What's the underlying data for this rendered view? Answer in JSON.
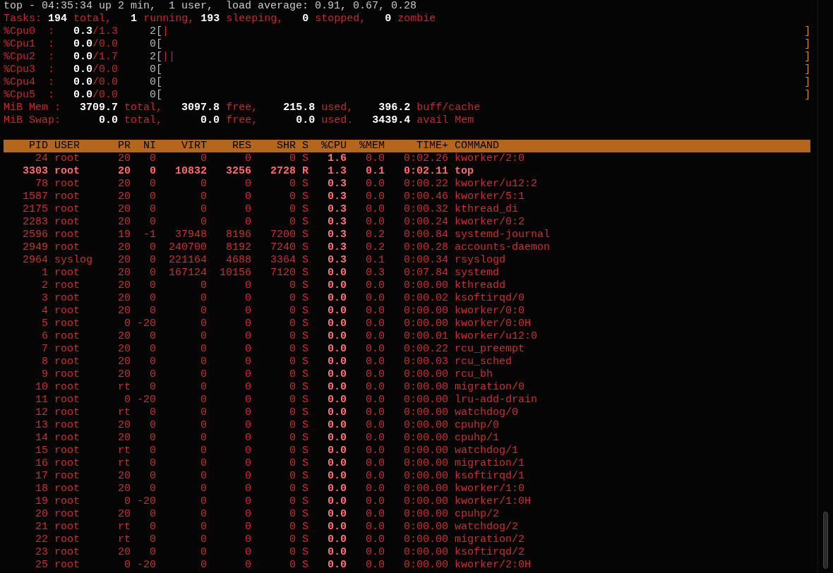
{
  "summary": {
    "uptime": "top - 04:35:34 up 2 min,  1 user,  load average: 0.91, 0.67, 0.28",
    "lines": [
      {
        "segments": [
          {
            "kind": "label",
            "text": "Tasks:"
          },
          {
            "kind": "value",
            "text": " 194"
          },
          {
            "kind": "label",
            "text": " total,"
          },
          {
            "kind": "value",
            "text": "   1"
          },
          {
            "kind": "label",
            "text": " running,"
          },
          {
            "kind": "value",
            "text": " 193"
          },
          {
            "kind": "label",
            "text": " sleeping,"
          },
          {
            "kind": "value",
            "text": "   0"
          },
          {
            "kind": "label",
            "text": " stopped,"
          },
          {
            "kind": "value",
            "text": "   0"
          },
          {
            "kind": "label",
            "text": " zombie"
          }
        ]
      },
      {
        "segments": [
          {
            "kind": "label",
            "text": "%Cpu0  :"
          },
          {
            "kind": "value",
            "text": "   0.3"
          },
          {
            "kind": "label",
            "text": "/1.3"
          },
          {
            "kind": "dim",
            "text": "     2["
          }
        ],
        "meter": "|",
        "meter_end": "]"
      },
      {
        "segments": [
          {
            "kind": "label",
            "text": "%Cpu1  :"
          },
          {
            "kind": "value",
            "text": "   0.0"
          },
          {
            "kind": "label",
            "text": "/0.0"
          },
          {
            "kind": "dim",
            "text": "     0["
          }
        ],
        "meter_end": "]"
      },
      {
        "segments": [
          {
            "kind": "label",
            "text": "%Cpu2  :"
          },
          {
            "kind": "value",
            "text": "   0.0"
          },
          {
            "kind": "label",
            "text": "/1.7"
          },
          {
            "kind": "dim",
            "text": "     2["
          }
        ],
        "meter": "||",
        "meter_end": "]"
      },
      {
        "segments": [
          {
            "kind": "label",
            "text": "%Cpu3  :"
          },
          {
            "kind": "value",
            "text": "   0.0"
          },
          {
            "kind": "label",
            "text": "/0.0"
          },
          {
            "kind": "dim",
            "text": "     0["
          }
        ],
        "meter_end": "]"
      },
      {
        "segments": [
          {
            "kind": "label",
            "text": "%Cpu4  :"
          },
          {
            "kind": "value",
            "text": "   0.0"
          },
          {
            "kind": "label",
            "text": "/0.0"
          },
          {
            "kind": "dim",
            "text": "     0["
          }
        ],
        "meter_end": "]"
      },
      {
        "segments": [
          {
            "kind": "label",
            "text": "%Cpu5  :"
          },
          {
            "kind": "value",
            "text": "   0.0"
          },
          {
            "kind": "label",
            "text": "/0.0"
          },
          {
            "kind": "dim",
            "text": "     0["
          }
        ],
        "meter_end": "]"
      },
      {
        "segments": [
          {
            "kind": "label",
            "text": "MiB Mem :"
          },
          {
            "kind": "value",
            "text": "   3709.7"
          },
          {
            "kind": "label",
            "text": " total,"
          },
          {
            "kind": "value",
            "text": "   3097.8"
          },
          {
            "kind": "label",
            "text": " free,"
          },
          {
            "kind": "value",
            "text": "    215.8"
          },
          {
            "kind": "label",
            "text": " used,"
          },
          {
            "kind": "value",
            "text": "    396.2"
          },
          {
            "kind": "label",
            "text": " buff/cache"
          }
        ]
      },
      {
        "segments": [
          {
            "kind": "label",
            "text": "MiB Swap:"
          },
          {
            "kind": "value",
            "text": "      0.0"
          },
          {
            "kind": "label",
            "text": " total,"
          },
          {
            "kind": "value",
            "text": "      0.0"
          },
          {
            "kind": "label",
            "text": " free,"
          },
          {
            "kind": "value",
            "text": "      0.0"
          },
          {
            "kind": "label",
            "text": " used."
          },
          {
            "kind": "value",
            "text": "   3439.4"
          },
          {
            "kind": "label",
            "text": " avail Mem"
          }
        ]
      }
    ]
  },
  "table": {
    "columns": [
      "PID",
      "USER",
      "PR",
      "NI",
      "VIRT",
      "RES",
      "SHR",
      "S",
      "%CPU",
      "%MEM",
      "TIME+",
      "COMMAND"
    ],
    "rows": [
      {
        "running": false,
        "cells": [
          "24",
          "root",
          "20",
          "0",
          "0",
          "0",
          "0",
          "S",
          "1.6",
          "0.0",
          "0:02.26",
          "kworker/2:0"
        ]
      },
      {
        "running": true,
        "cells": [
          "3303",
          "root",
          "20",
          "0",
          "10832",
          "3256",
          "2728",
          "R",
          "1.3",
          "0.1",
          "0:02.11",
          "top"
        ]
      },
      {
        "running": false,
        "cells": [
          "78",
          "root",
          "20",
          "0",
          "0",
          "0",
          "0",
          "S",
          "0.3",
          "0.0",
          "0:00.22",
          "kworker/u12:2"
        ]
      },
      {
        "running": false,
        "cells": [
          "1587",
          "root",
          "20",
          "0",
          "0",
          "0",
          "0",
          "S",
          "0.3",
          "0.0",
          "0:00.46",
          "kworker/5:1"
        ]
      },
      {
        "running": false,
        "cells": [
          "2175",
          "root",
          "20",
          "0",
          "0",
          "0",
          "0",
          "S",
          "0.3",
          "0.0",
          "0:00.32",
          "kthread_di"
        ]
      },
      {
        "running": false,
        "cells": [
          "2283",
          "root",
          "20",
          "0",
          "0",
          "0",
          "0",
          "S",
          "0.3",
          "0.0",
          "0:00.24",
          "kworker/0:2"
        ]
      },
      {
        "running": false,
        "cells": [
          "2596",
          "root",
          "19",
          "-1",
          "37948",
          "8196",
          "7200",
          "S",
          "0.3",
          "0.2",
          "0:00.84",
          "systemd-journal"
        ]
      },
      {
        "running": false,
        "cells": [
          "2949",
          "root",
          "20",
          "0",
          "240700",
          "8192",
          "7240",
          "S",
          "0.3",
          "0.2",
          "0:00.28",
          "accounts-daemon"
        ]
      },
      {
        "running": false,
        "cells": [
          "2964",
          "syslog",
          "20",
          "0",
          "221164",
          "4688",
          "3364",
          "S",
          "0.3",
          "0.1",
          "0:00.34",
          "rsyslogd"
        ]
      },
      {
        "running": false,
        "cells": [
          "1",
          "root",
          "20",
          "0",
          "167124",
          "10156",
          "7120",
          "S",
          "0.0",
          "0.3",
          "0:07.84",
          "systemd"
        ]
      },
      {
        "running": false,
        "cells": [
          "2",
          "root",
          "20",
          "0",
          "0",
          "0",
          "0",
          "S",
          "0.0",
          "0.0",
          "0:00.00",
          "kthreadd"
        ]
      },
      {
        "running": false,
        "cells": [
          "3",
          "root",
          "20",
          "0",
          "0",
          "0",
          "0",
          "S",
          "0.0",
          "0.0",
          "0:00.02",
          "ksoftirqd/0"
        ]
      },
      {
        "running": false,
        "cells": [
          "4",
          "root",
          "20",
          "0",
          "0",
          "0",
          "0",
          "S",
          "0.0",
          "0.0",
          "0:00.00",
          "kworker/0:0"
        ]
      },
      {
        "running": false,
        "cells": [
          "5",
          "root",
          "0",
          "-20",
          "0",
          "0",
          "0",
          "S",
          "0.0",
          "0.0",
          "0:00.00",
          "kworker/0:0H"
        ]
      },
      {
        "running": false,
        "cells": [
          "6",
          "root",
          "20",
          "0",
          "0",
          "0",
          "0",
          "S",
          "0.0",
          "0.0",
          "0:00.01",
          "kworker/u12:0"
        ]
      },
      {
        "running": false,
        "cells": [
          "7",
          "root",
          "20",
          "0",
          "0",
          "0",
          "0",
          "S",
          "0.0",
          "0.0",
          "0:00.22",
          "rcu_preempt"
        ]
      },
      {
        "running": false,
        "cells": [
          "8",
          "root",
          "20",
          "0",
          "0",
          "0",
          "0",
          "S",
          "0.0",
          "0.0",
          "0:00.03",
          "rcu_sched"
        ]
      },
      {
        "running": false,
        "cells": [
          "9",
          "root",
          "20",
          "0",
          "0",
          "0",
          "0",
          "S",
          "0.0",
          "0.0",
          "0:00.00",
          "rcu_bh"
        ]
      },
      {
        "running": false,
        "cells": [
          "10",
          "root",
          "rt",
          "0",
          "0",
          "0",
          "0",
          "S",
          "0.0",
          "0.0",
          "0:00.00",
          "migration/0"
        ]
      },
      {
        "running": false,
        "cells": [
          "11",
          "root",
          "0",
          "-20",
          "0",
          "0",
          "0",
          "S",
          "0.0",
          "0.0",
          "0:00.00",
          "lru-add-drain"
        ]
      },
      {
        "running": false,
        "cells": [
          "12",
          "root",
          "rt",
          "0",
          "0",
          "0",
          "0",
          "S",
          "0.0",
          "0.0",
          "0:00.00",
          "watchdog/0"
        ]
      },
      {
        "running": false,
        "cells": [
          "13",
          "root",
          "20",
          "0",
          "0",
          "0",
          "0",
          "S",
          "0.0",
          "0.0",
          "0:00.00",
          "cpuhp/0"
        ]
      },
      {
        "running": false,
        "cells": [
          "14",
          "root",
          "20",
          "0",
          "0",
          "0",
          "0",
          "S",
          "0.0",
          "0.0",
          "0:00.00",
          "cpuhp/1"
        ]
      },
      {
        "running": false,
        "cells": [
          "15",
          "root",
          "rt",
          "0",
          "0",
          "0",
          "0",
          "S",
          "0.0",
          "0.0",
          "0:00.00",
          "watchdog/1"
        ]
      },
      {
        "running": false,
        "cells": [
          "16",
          "root",
          "rt",
          "0",
          "0",
          "0",
          "0",
          "S",
          "0.0",
          "0.0",
          "0:00.00",
          "migration/1"
        ]
      },
      {
        "running": false,
        "cells": [
          "17",
          "root",
          "20",
          "0",
          "0",
          "0",
          "0",
          "S",
          "0.0",
          "0.0",
          "0:00.00",
          "ksoftirqd/1"
        ]
      },
      {
        "running": false,
        "cells": [
          "18",
          "root",
          "20",
          "0",
          "0",
          "0",
          "0",
          "S",
          "0.0",
          "0.0",
          "0:00.00",
          "kworker/1:0"
        ]
      },
      {
        "running": false,
        "cells": [
          "19",
          "root",
          "0",
          "-20",
          "0",
          "0",
          "0",
          "S",
          "0.0",
          "0.0",
          "0:00.00",
          "kworker/1:0H"
        ]
      },
      {
        "running": false,
        "cells": [
          "20",
          "root",
          "20",
          "0",
          "0",
          "0",
          "0",
          "S",
          "0.0",
          "0.0",
          "0:00.00",
          "cpuhp/2"
        ]
      },
      {
        "running": false,
        "cells": [
          "21",
          "root",
          "rt",
          "0",
          "0",
          "0",
          "0",
          "S",
          "0.0",
          "0.0",
          "0:00.00",
          "watchdog/2"
        ]
      },
      {
        "running": false,
        "cells": [
          "22",
          "root",
          "rt",
          "0",
          "0",
          "0",
          "0",
          "S",
          "0.0",
          "0.0",
          "0:00.00",
          "migration/2"
        ]
      },
      {
        "running": false,
        "cells": [
          "23",
          "root",
          "20",
          "0",
          "0",
          "0",
          "0",
          "S",
          "0.0",
          "0.0",
          "0:00.00",
          "ksoftirqd/2"
        ]
      },
      {
        "running": false,
        "cells": [
          "25",
          "root",
          "0",
          "-20",
          "0",
          "0",
          "0",
          "S",
          "0.0",
          "0.0",
          "0:00.00",
          "kworker/2:0H"
        ]
      }
    ]
  }
}
